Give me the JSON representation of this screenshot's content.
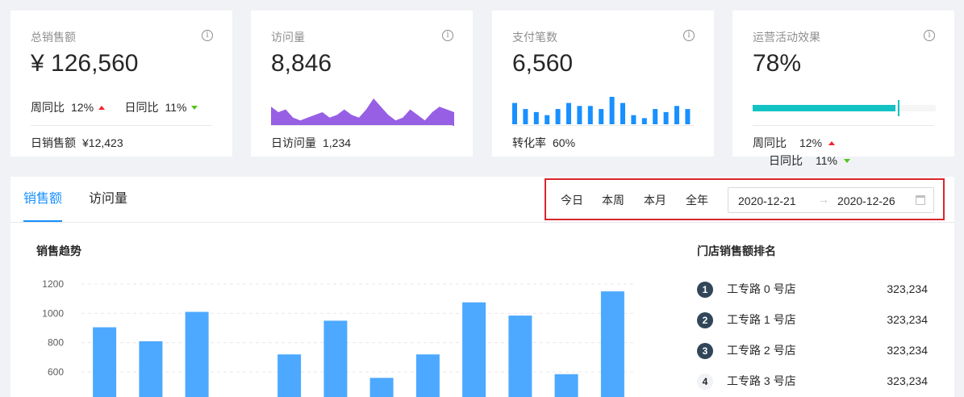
{
  "cards": [
    {
      "title": "总销售额",
      "value": "¥ 126,560",
      "wow_label": "周同比",
      "wow_value": "12%",
      "dod_label": "日同比",
      "dod_value": "11%",
      "foot_label": "日销售额",
      "foot_value": "¥12,423"
    },
    {
      "title": "访问量",
      "value": "8,846",
      "foot_label": "日访问量",
      "foot_value": "1,234"
    },
    {
      "title": "支付笔数",
      "value": "6,560",
      "foot_label": "转化率",
      "foot_value": "60%"
    },
    {
      "title": "运营活动效果",
      "value": "78%",
      "progress": 0.78,
      "wow_label": "周同比",
      "wow_value": "12%",
      "dod_label": "日同比",
      "dod_value": "11%"
    }
  ],
  "tabs": {
    "sales": "销售额",
    "visits": "访问量"
  },
  "ranges": {
    "today": "今日",
    "week": "本周",
    "month": "本月",
    "year": "全年"
  },
  "picker": {
    "start": "2020-12-21",
    "end": "2020-12-26"
  },
  "trend_title": "销售趋势",
  "rank_title": "门店销售额排名",
  "ranking": [
    {
      "rank": "1",
      "name": "工专路 0 号店",
      "value": "323,234"
    },
    {
      "rank": "2",
      "name": "工专路 1 号店",
      "value": "323,234"
    },
    {
      "rank": "3",
      "name": "工专路 2 号店",
      "value": "323,234"
    },
    {
      "rank": "4",
      "name": "工专路 3 号店",
      "value": "323,234"
    }
  ],
  "colors": {
    "accent": "#1890ff",
    "bar": "#4da9ff",
    "area": "#975fe4",
    "progress": "#13c2c2",
    "up": "#f5222d",
    "down": "#52c41a"
  },
  "visits_area": [
    7,
    5,
    6,
    3,
    2,
    3,
    4,
    5,
    3,
    4,
    6,
    4,
    3,
    6,
    10,
    7,
    4,
    2,
    3,
    6,
    4,
    2,
    5,
    7,
    6,
    5
  ],
  "payments_bars": [
    7,
    5,
    4,
    3,
    5,
    7,
    6,
    6,
    5,
    9,
    7,
    3,
    2,
    5,
    4,
    6,
    5
  ],
  "chart_data": {
    "type": "bar",
    "title": "销售趋势",
    "yticks": [
      600,
      800,
      1000,
      1200
    ],
    "ylim": [
      300,
      1250
    ],
    "values": [
      905,
      810,
      1010,
      null,
      720,
      950,
      560,
      720,
      1075,
      985,
      585,
      1150
    ],
    "grid": true
  }
}
